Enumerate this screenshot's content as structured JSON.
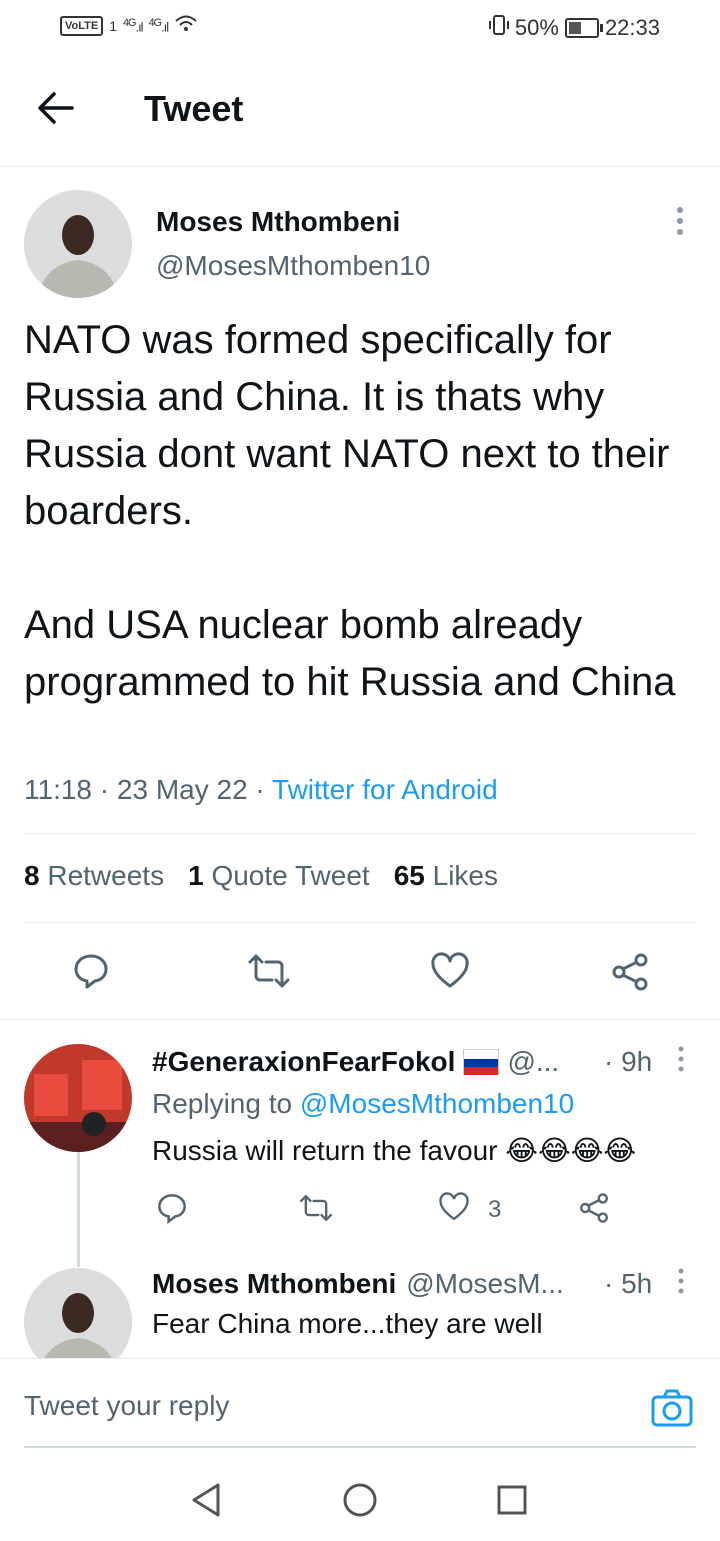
{
  "status_bar": {
    "volte": "VoLTE",
    "sim": "1",
    "net1": "4G",
    "net2": "4G",
    "battery_pct": "50%",
    "time": "22:33"
  },
  "header": {
    "title": "Tweet"
  },
  "tweet": {
    "author_name": "Moses Mthombeni",
    "author_handle": "@MosesMthomben10",
    "text": "NATO was formed specifically for Russia and China. It is thats why Russia dont want NATO next to their boarders.\n\nAnd USA nuclear bomb already programmed to hit Russia and China",
    "time": "11:18",
    "date": "23 May 22",
    "source": "Twitter for Android",
    "retweets_count": "8",
    "retweets_label": "Retweets",
    "quotes_count": "1",
    "quotes_label": "Quote Tweet",
    "likes_count": "65",
    "likes_label": "Likes"
  },
  "replies": [
    {
      "name": "#GeneraxionFearFokol",
      "handle": "@...",
      "age": "· 9h",
      "replying_label": "Replying to",
      "replying_to": "@MosesMthomben10",
      "text": "Russia will return the favour 😂😂😂😂",
      "likes": "3"
    },
    {
      "name": "Moses Mthombeni",
      "handle": "@MosesM...",
      "age": "· 5h",
      "text": "Fear China more...they are well"
    }
  ],
  "reply_bar": {
    "placeholder": "Tweet your reply"
  },
  "colors": {
    "accent": "#1d9bf0",
    "muted": "#536471"
  }
}
